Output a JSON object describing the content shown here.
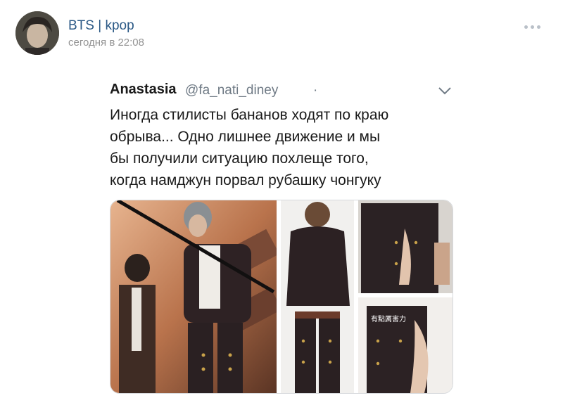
{
  "post": {
    "group_name": "BTS | kpop",
    "time": "сегодня в 22:08",
    "avatar_icon": "avatar-photo",
    "more_icon": "more-dots-icon"
  },
  "tweet": {
    "author": "Anastasia",
    "handle": "@fa_nati_diney",
    "dot": "·",
    "chevron_icon": "chevron-down-icon",
    "text_lines": [
      "Иногда стилисты бананов ходят по краю",
      "обрыва... Одно лишнее движение и мы",
      "бы получили ситуацию похлеще того,",
      "когда намджун порвал рубашку чонгуку"
    ],
    "photo_caption": "有點厲害力"
  },
  "colors": {
    "link": "#2a5885",
    "meta": "#939393",
    "stage_warm": "#c98a5e",
    "suit_dark": "#3a2a2c"
  }
}
